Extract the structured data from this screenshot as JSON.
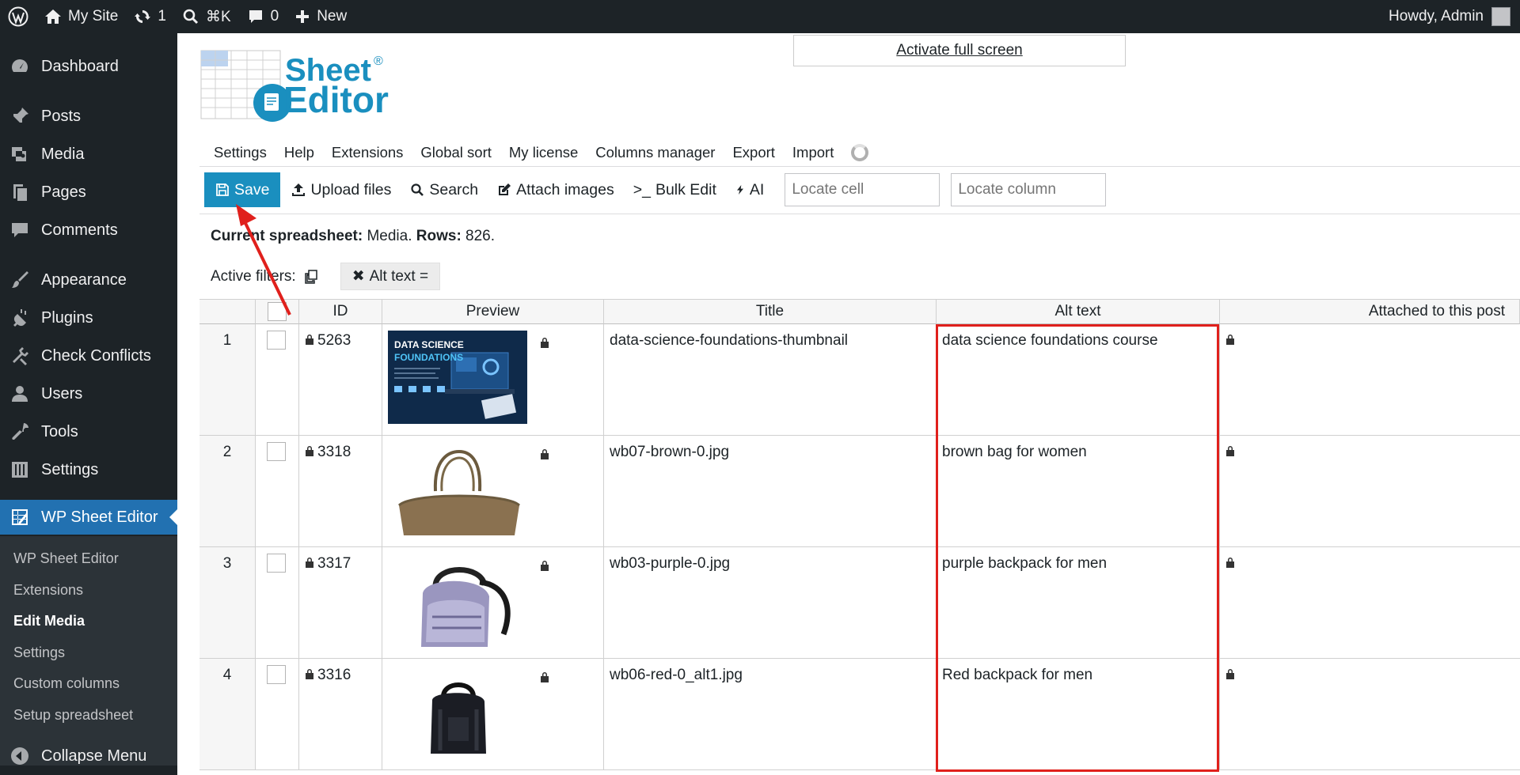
{
  "adminbar": {
    "site_name": "My Site",
    "updates_count": "1",
    "search_shortcut": "⌘K",
    "comments_count": "0",
    "new_label": "New",
    "howdy": "Howdy, Admin"
  },
  "sidebar": {
    "items": [
      {
        "label": "Dashboard",
        "icon": "dashboard-icon"
      },
      {
        "label": "Posts",
        "icon": "pin-icon"
      },
      {
        "label": "Media",
        "icon": "media-icon"
      },
      {
        "label": "Pages",
        "icon": "pages-icon"
      },
      {
        "label": "Comments",
        "icon": "comment-icon"
      },
      {
        "label": "Appearance",
        "icon": "brush-icon"
      },
      {
        "label": "Plugins",
        "icon": "plug-icon"
      },
      {
        "label": "Check Conflicts",
        "icon": "tools-icon"
      },
      {
        "label": "Users",
        "icon": "user-icon"
      },
      {
        "label": "Tools",
        "icon": "wrench-icon"
      },
      {
        "label": "Settings",
        "icon": "sliders-icon"
      },
      {
        "label": "WP Sheet Editor",
        "icon": "sheet-icon"
      }
    ],
    "submenu": [
      "WP Sheet Editor",
      "Extensions",
      "Edit Media",
      "Settings",
      "Custom columns",
      "Setup spreadsheet"
    ],
    "collapse_label": "Collapse Menu"
  },
  "logo": {
    "line1": "Sheet",
    "line2": "Editor",
    "mark": "®"
  },
  "fullscreen_label": "Activate full screen",
  "topnav": [
    "Settings",
    "Help",
    "Extensions",
    "Global sort",
    "My license",
    "Columns manager",
    "Export",
    "Import"
  ],
  "toolbar": {
    "save": "Save",
    "upload": "Upload files",
    "search": "Search",
    "attach": "Attach images",
    "bulk_prefix": ">_",
    "bulk": "Bulk Edit",
    "ai": "AI",
    "locate_cell": "Locate cell",
    "locate_column": "Locate column"
  },
  "info": {
    "label1": "Current spreadsheet:",
    "value1": "Media.",
    "label2": "Rows:",
    "value2": "826."
  },
  "filters": {
    "label": "Active filters:",
    "chip": "Alt text ="
  },
  "grid": {
    "headers": [
      "",
      "",
      "ID",
      "Preview",
      "Title",
      "Alt text",
      "Attached to this post"
    ],
    "rows": [
      {
        "num": "1",
        "id": "5263",
        "title": "data-science-foundations-thumbnail",
        "alt": "data science foundations course",
        "thumb_line1": "DATA SCIENCE",
        "thumb_line2": "FOUNDATIONS"
      },
      {
        "num": "2",
        "id": "3318",
        "title": "wb07-brown-0.jpg",
        "alt": "brown bag for women"
      },
      {
        "num": "3",
        "id": "3317",
        "title": "wb03-purple-0.jpg",
        "alt": "purple backpack for men"
      },
      {
        "num": "4",
        "id": "3316",
        "title": "wb06-red-0_alt1.jpg",
        "alt": "Red backpack for men"
      }
    ]
  },
  "colors": {
    "accent": "#2271b1",
    "save": "#1a8fbf",
    "highlight": "#e0201c",
    "adminbar": "#1d2327"
  }
}
